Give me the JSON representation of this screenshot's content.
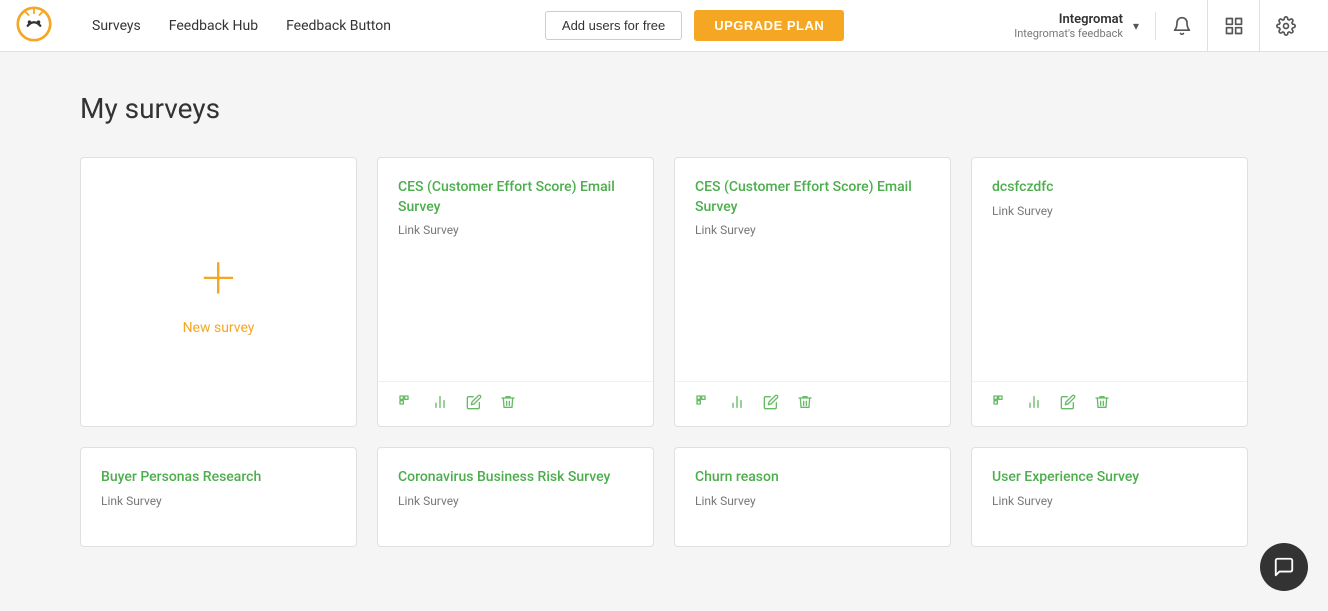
{
  "header": {
    "logo_alt": "Nicereply logo",
    "nav": [
      {
        "id": "surveys",
        "label": "Surveys"
      },
      {
        "id": "feedback-hub",
        "label": "Feedback Hub"
      },
      {
        "id": "feedback-button",
        "label": "Feedback Button"
      }
    ],
    "add_users_label": "Add users for free",
    "upgrade_label": "UPGRADE PLAN",
    "user": {
      "name": "Integromat",
      "subtitle": "Integromat's feedback"
    },
    "icon_bell": "🔔",
    "icon_bookmark": "📋",
    "icon_gear": "⚙"
  },
  "main": {
    "page_title": "My surveys",
    "new_survey_label": "New survey",
    "new_survey_plus": "+",
    "surveys": [
      {
        "id": "ces1",
        "title": "CES (Customer Effort Score) Email Survey",
        "type": "Link Survey"
      },
      {
        "id": "ces2",
        "title": "CES (Customer Effort Score) Email Survey",
        "type": "Link Survey"
      },
      {
        "id": "dcsfczdfc",
        "title": "dcsfczdfc",
        "type": "Link Survey"
      }
    ],
    "bottom_surveys": [
      {
        "id": "buyer",
        "title": "Buyer Personas Research",
        "type": "Link Survey"
      },
      {
        "id": "coronavirus",
        "title": "Coronavirus Business Risk Survey",
        "type": "Link Survey"
      },
      {
        "id": "churn",
        "title": "Churn reason",
        "type": "Link Survey"
      },
      {
        "id": "ux",
        "title": "User Experience Survey",
        "type": "Link Survey"
      }
    ]
  },
  "card_actions": {
    "preview": "⊞",
    "stats": "📊",
    "edit": "✎",
    "delete": "🗑"
  }
}
